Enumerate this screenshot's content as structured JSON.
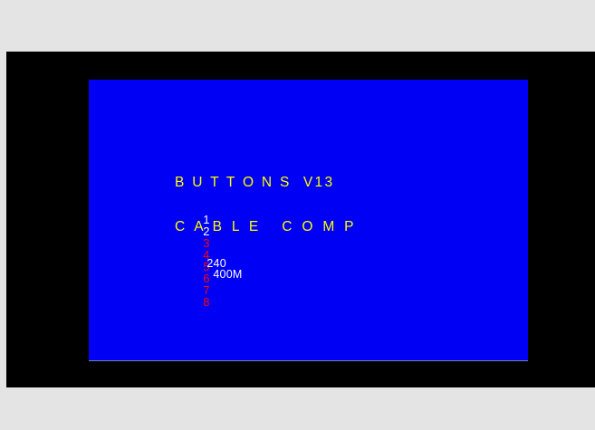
{
  "osd": {
    "title": "B U T T O N S  V13",
    "buttons": [
      {
        "label": "1",
        "state": "on"
      },
      {
        "label": "2",
        "state": "on"
      },
      {
        "label": "3",
        "state": "off"
      },
      {
        "label": "4",
        "state": "off"
      },
      {
        "label": "5",
        "state": "off"
      },
      {
        "label": "6",
        "state": "off"
      },
      {
        "label": "7",
        "state": "off"
      },
      {
        "label": "8",
        "state": "off"
      }
    ],
    "cable_heading": "C A B L E   C O M P",
    "cable_values": [
      "240",
      "400M"
    ]
  },
  "colors": {
    "page_background": "#e4e4e4",
    "frame": "#000000",
    "screen": "#0000f4",
    "heading_text": "#ffff00",
    "active_text": "#ffffff",
    "inactive_text": "#ff0000"
  }
}
